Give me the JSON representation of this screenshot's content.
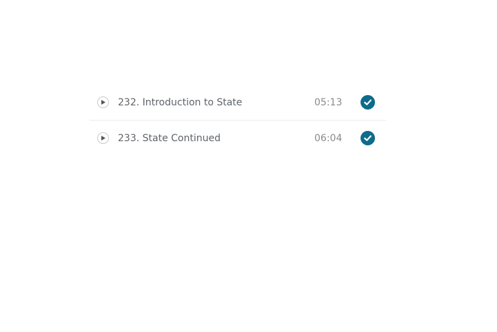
{
  "colors": {
    "complete_check": "#0f6b8a",
    "divider": "#ececec"
  },
  "lectures": [
    {
      "title": "232. Introduction to State",
      "duration": "05:13",
      "icon": "play-icon",
      "status_icon": "check-circle-icon",
      "completed": true
    },
    {
      "title": "233. State Continued",
      "duration": "06:04",
      "icon": "play-icon",
      "status_icon": "check-circle-icon",
      "completed": true
    }
  ]
}
